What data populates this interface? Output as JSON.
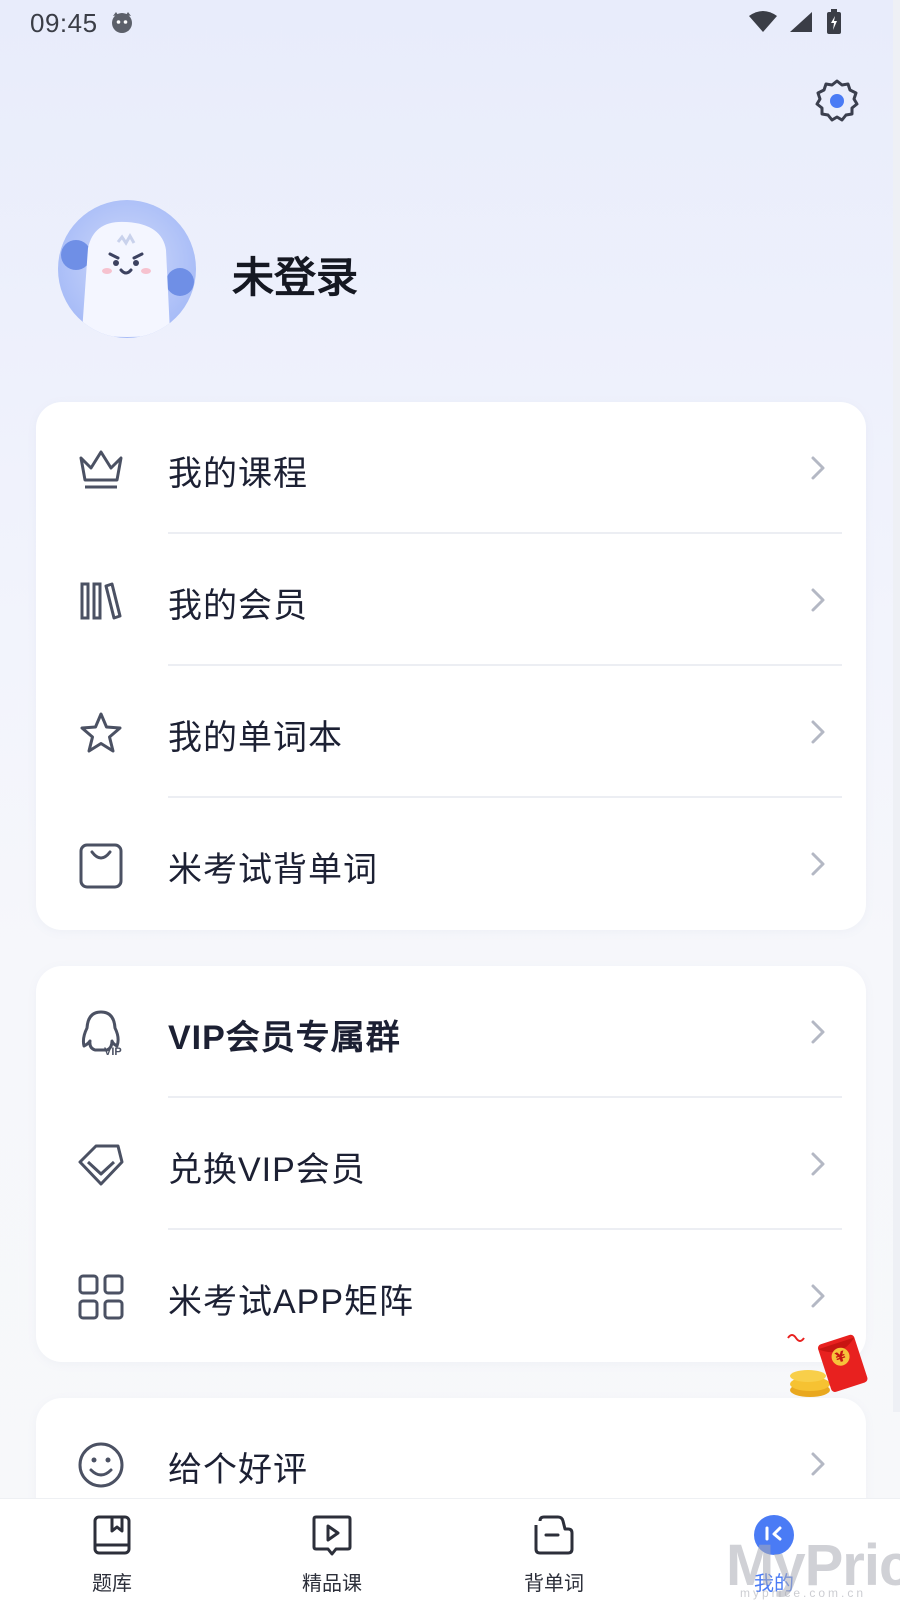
{
  "status_bar": {
    "time": "09:45"
  },
  "profile": {
    "username": "未登录"
  },
  "card1": {
    "items": [
      {
        "label": "我的课程",
        "icon": "crown-icon"
      },
      {
        "label": "我的会员",
        "icon": "books-icon"
      },
      {
        "label": "我的单词本",
        "icon": "star-icon"
      },
      {
        "label": "米考试背单词",
        "icon": "bag-icon"
      }
    ]
  },
  "card2": {
    "items": [
      {
        "label": "VIP会员专属群",
        "icon": "qq-vip-icon"
      },
      {
        "label": "兑换VIP会员",
        "icon": "diamond-icon"
      },
      {
        "label": "米考试APP矩阵",
        "icon": "grid-icon"
      }
    ]
  },
  "card3": {
    "items": [
      {
        "label": "给个好评",
        "icon": "smiley-icon"
      }
    ]
  },
  "promo": {
    "symbol": "¥"
  },
  "tabs": [
    {
      "label": "题库",
      "icon": "book-icon",
      "active": false
    },
    {
      "label": "精品课",
      "icon": "video-icon",
      "active": false
    },
    {
      "label": "背单词",
      "icon": "flashcard-icon",
      "active": false
    },
    {
      "label": "我的",
      "icon": "profile-icon",
      "active": true
    }
  ],
  "watermark": {
    "text": "MyPrice",
    "sub": "myprice.com.cn"
  },
  "colors": {
    "accent": "#4a7bf5",
    "text": "#1c2033",
    "icon": "#4b5163"
  }
}
